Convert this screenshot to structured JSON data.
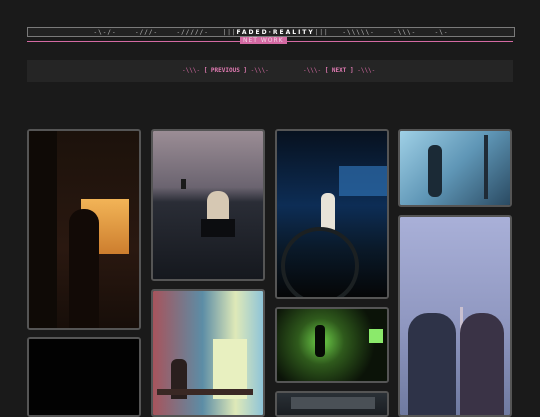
{
  "header": {
    "left_pattern": "-\\-/-    -///-    -/////-   |||",
    "title": "FADED·REALITY",
    "right_pattern": "|||   -\\\\\\\\\\-    -\\\\\\-    -\\-",
    "subtitle": "NET WORK"
  },
  "nav": {
    "prev_left": "-\\\\\\-",
    "prev_label": "[ PREVIOUS ]",
    "prev_right": "-\\\\\\-",
    "next_left": "-\\\\\\-",
    "next_label": "[ NEXT ]",
    "next_right": "-\\\\\\-"
  },
  "gallery": {
    "photos": [
      {
        "subject": "silhouette at sunset window",
        "accent": "#e39a3a"
      },
      {
        "subject": "person in dark water at dusk",
        "accent": "#8a7a86"
      },
      {
        "subject": "person lit by headlights at night",
        "accent": "#2d6fb0"
      },
      {
        "subject": "shadow on blue wall",
        "accent": "#7fb2cc"
      },
      {
        "subject": "black frame",
        "accent": "#000000"
      },
      {
        "subject": "two people in pink and teal room",
        "accent": "#b56a8a"
      },
      {
        "subject": "figure in green light",
        "accent": "#6fd14a"
      },
      {
        "subject": "couple overlooking city at dusk",
        "accent": "#9aa4c8"
      },
      {
        "subject": "dark frame",
        "accent": "#2a3036"
      }
    ]
  }
}
